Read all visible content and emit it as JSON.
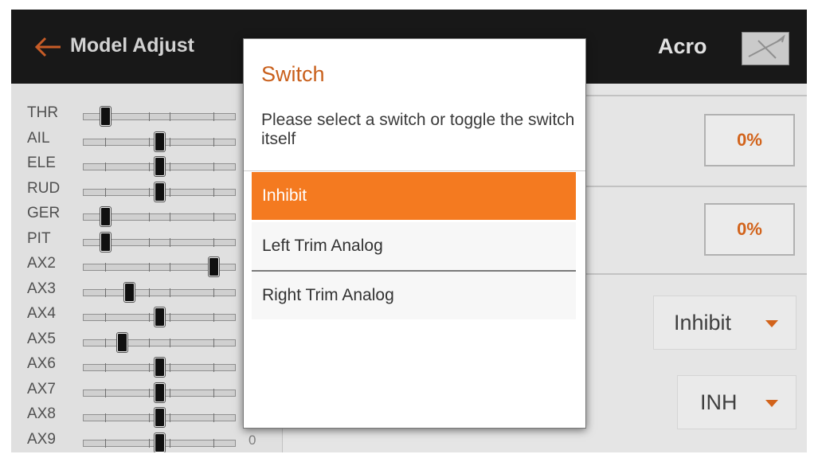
{
  "header": {
    "title": "Model Adjust",
    "mode": "Acro",
    "back_icon": "arrow-left-icon",
    "model_icon": "airplane-icon",
    "accent_color": "#f47a20"
  },
  "channels": [
    {
      "label": "THR",
      "value": "",
      "position": 0.14
    },
    {
      "label": "AIL",
      "value": "",
      "position": 0.5
    },
    {
      "label": "ELE",
      "value": "",
      "position": 0.5
    },
    {
      "label": "RUD",
      "value": "",
      "position": 0.5
    },
    {
      "label": "GER",
      "value": "",
      "position": 0.14
    },
    {
      "label": "PIT",
      "value": "",
      "position": 0.14
    },
    {
      "label": "AX2",
      "value": "",
      "position": 0.86
    },
    {
      "label": "AX3",
      "value": "",
      "position": 0.3
    },
    {
      "label": "AX4",
      "value": "",
      "position": 0.5
    },
    {
      "label": "AX5",
      "value": "",
      "position": 0.25
    },
    {
      "label": "AX6",
      "value": "",
      "position": 0.5
    },
    {
      "label": "AX7",
      "value": "",
      "position": 0.5
    },
    {
      "label": "AX8",
      "value": "",
      "position": 0.5
    },
    {
      "label": "AX9",
      "value": "0",
      "position": 0.5
    }
  ],
  "right": {
    "box1": "0%",
    "box2": "0%",
    "dropdown1": "Inhibit",
    "dropdown2": "INH"
  },
  "dialog": {
    "title": "Switch",
    "message": "Please select a switch or toggle the switch itself",
    "options": [
      {
        "label": "Inhibit",
        "selected": true
      },
      {
        "label": "Left Trim Analog",
        "selected": false
      },
      {
        "label": "Right Trim Analog",
        "selected": false
      }
    ]
  }
}
